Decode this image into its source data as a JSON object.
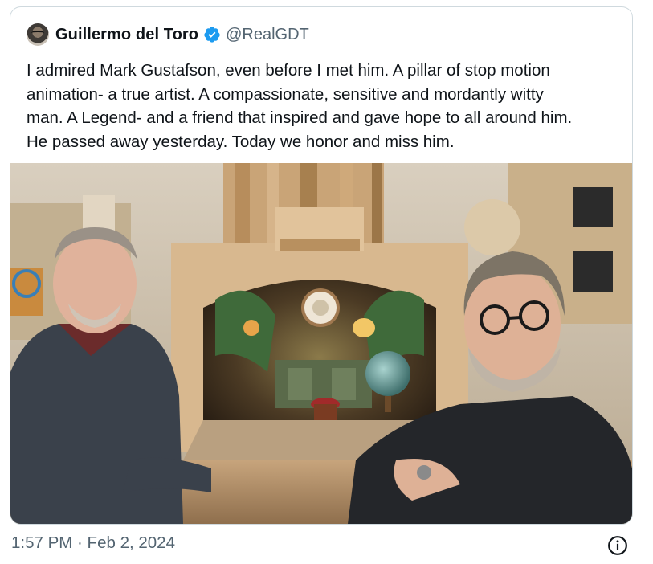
{
  "tweet": {
    "author": {
      "display_name": "Guillermo del Toro",
      "handle": "@RealGDT",
      "verified": true,
      "avatar_icon": "profile-avatar"
    },
    "text_lines": [
      "I admired Mark Gustafson, even before I met him.  A pillar of stop motion",
      "animation- a true artist.  A compassionate, sensitive and mordantly witty",
      "man.  A Legend- and a friend that inspired and gave hope to all around him.",
      "He passed away yesterday.  Today we honor and miss him."
    ],
    "media": {
      "kind": "photo",
      "alt_icon": "photo-two-men-with-stop-motion-set"
    },
    "timestamp": "1:57 PM · Feb 2, 2024"
  },
  "colors": {
    "text_primary": "#0f1419",
    "text_secondary": "#536471",
    "verified_blue": "#1d9bf0",
    "border": "#cfd9de"
  },
  "icons": {
    "verified": "verified-badge-icon",
    "info": "info-icon"
  }
}
